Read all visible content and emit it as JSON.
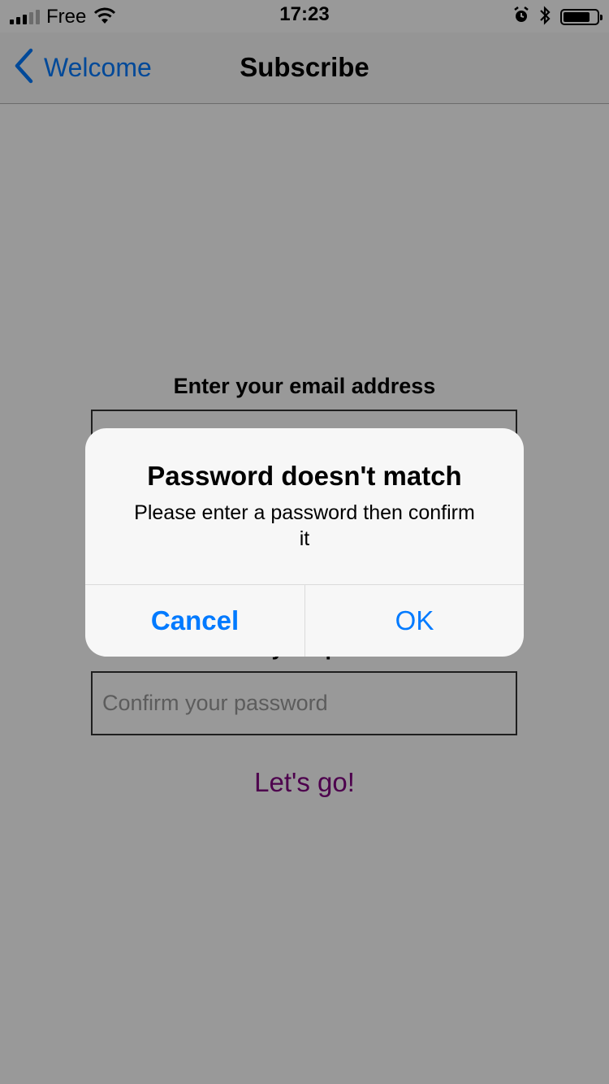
{
  "status_bar": {
    "carrier": "Free",
    "time": "17:23",
    "icons": [
      "signal-icon",
      "wifi-icon",
      "alarm-icon",
      "bluetooth-icon",
      "battery-icon"
    ],
    "signal_bars_active": 3,
    "signal_bars_total": 5,
    "battery_level": 0.8
  },
  "nav": {
    "back_label": "Welcome",
    "title": "Subscribe"
  },
  "form": {
    "email_label": "Enter your email address",
    "confirm_label": "Confirm your password",
    "confirm_placeholder": "Confirm your password",
    "submit_label": "Let's go!"
  },
  "alert": {
    "title": "Password doesn't match",
    "message": "Please enter a password then confirm it",
    "cancel_label": "Cancel",
    "ok_label": "OK"
  },
  "colors": {
    "accent": "#007aff",
    "link": "#800080",
    "overlay": "rgba(0,0,0,0.4)"
  }
}
